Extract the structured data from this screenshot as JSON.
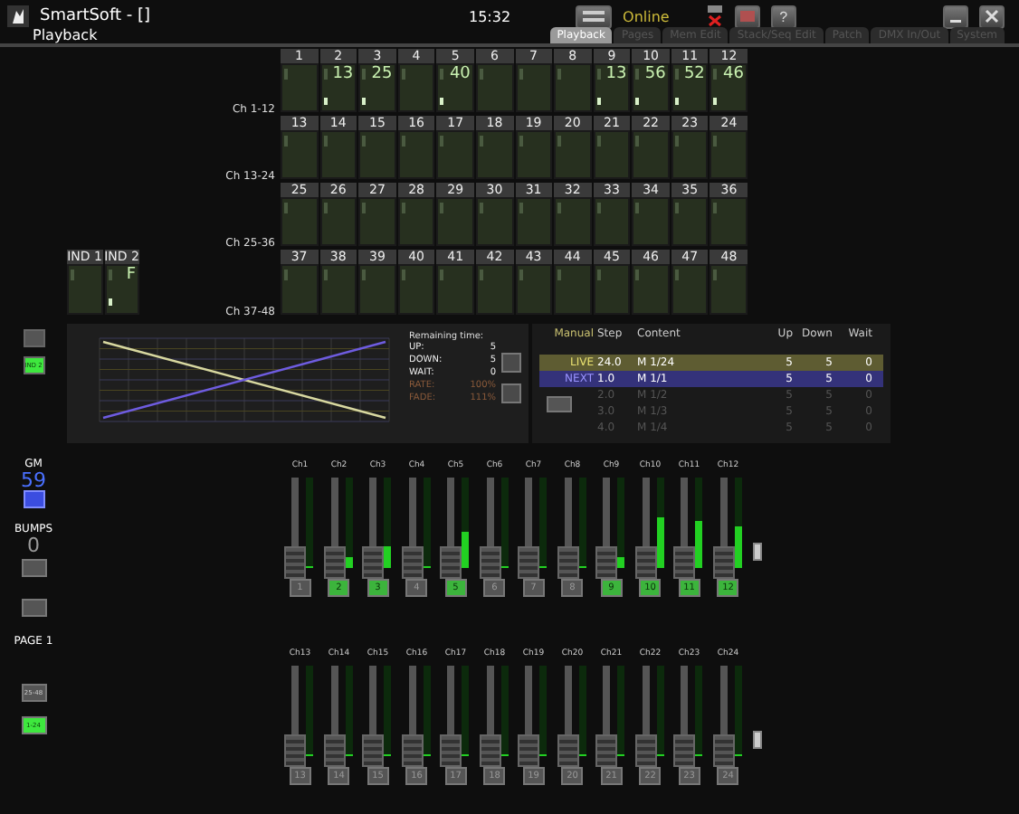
{
  "window": {
    "title": "SmartSoft - []",
    "clock": "15:32",
    "status": "Online",
    "help": "?"
  },
  "page_title": "Playback",
  "tabs": [
    {
      "label": "Playback",
      "selected": true
    },
    {
      "label": "Pages",
      "selected": false
    },
    {
      "label": "Mem Edit",
      "selected": false
    },
    {
      "label": "Stack/Seq Edit",
      "selected": false
    },
    {
      "label": "Patch",
      "selected": false
    },
    {
      "label": "DMX In/Out",
      "selected": false
    },
    {
      "label": "System",
      "selected": false
    }
  ],
  "channel_rows": [
    {
      "label": "Ch 1-12",
      "channels": [
        {
          "number": "1"
        },
        {
          "number": "2",
          "value": "13"
        },
        {
          "number": "3",
          "value": "25"
        },
        {
          "number": "4"
        },
        {
          "number": "5",
          "value": "40"
        },
        {
          "number": "6"
        },
        {
          "number": "7"
        },
        {
          "number": "8"
        },
        {
          "number": "9",
          "value": "13"
        },
        {
          "number": "10",
          "value": "56"
        },
        {
          "number": "11",
          "value": "52"
        },
        {
          "number": "12",
          "value": "46"
        }
      ]
    },
    {
      "label": "Ch 13-24",
      "channels": [
        {
          "number": "13"
        },
        {
          "number": "14"
        },
        {
          "number": "15"
        },
        {
          "number": "16"
        },
        {
          "number": "17"
        },
        {
          "number": "18"
        },
        {
          "number": "19"
        },
        {
          "number": "20"
        },
        {
          "number": "21"
        },
        {
          "number": "22"
        },
        {
          "number": "23"
        },
        {
          "number": "24"
        }
      ]
    },
    {
      "label": "Ch 25-36",
      "channels": [
        {
          "number": "25"
        },
        {
          "number": "26"
        },
        {
          "number": "27"
        },
        {
          "number": "28"
        },
        {
          "number": "29"
        },
        {
          "number": "30"
        },
        {
          "number": "31"
        },
        {
          "number": "32"
        },
        {
          "number": "33"
        },
        {
          "number": "34"
        },
        {
          "number": "35"
        },
        {
          "number": "36"
        }
      ]
    },
    {
      "label": "Ch 37-48",
      "channels": [
        {
          "number": "37"
        },
        {
          "number": "38"
        },
        {
          "number": "39"
        },
        {
          "number": "40"
        },
        {
          "number": "41"
        },
        {
          "number": "42"
        },
        {
          "number": "43"
        },
        {
          "number": "44"
        },
        {
          "number": "45"
        },
        {
          "number": "46"
        },
        {
          "number": "47"
        },
        {
          "number": "48"
        }
      ]
    }
  ],
  "indicators": [
    {
      "label": "IND 1"
    },
    {
      "label": "IND 2",
      "value": "F"
    }
  ],
  "ind_button": {
    "label": "IND 2",
    "selected": true
  },
  "remaining_time": {
    "title": "Remaining time:",
    "rows": [
      {
        "label": "UP:",
        "value": "5",
        "kind": "time"
      },
      {
        "label": "DOWN:",
        "value": "5",
        "kind": "time"
      },
      {
        "label": "WAIT:",
        "value": "0",
        "kind": "time"
      },
      {
        "label": "RATE:",
        "value": "100%",
        "kind": "rate"
      },
      {
        "label": "FADE:",
        "value": "111%",
        "kind": "rate"
      }
    ]
  },
  "cue_list": {
    "columns": [
      "Manual",
      "Step",
      "Content",
      "Up",
      "Down",
      "Wait"
    ],
    "rows": [
      {
        "kind": "live",
        "label": "LIVE",
        "step": "24.0",
        "content": "M 1/24",
        "up": "5",
        "down": "5",
        "wait": "0"
      },
      {
        "kind": "next",
        "label": "NEXT",
        "step": "1.0",
        "content": "M 1/1",
        "up": "5",
        "down": "5",
        "wait": "0"
      },
      {
        "kind": "pending",
        "step": "2.0",
        "content": "M 1/2",
        "up": "5",
        "down": "5",
        "wait": "0"
      },
      {
        "kind": "pending",
        "step": "3.0",
        "content": "M 1/3",
        "up": "5",
        "down": "5",
        "wait": "0"
      },
      {
        "kind": "pending",
        "step": "4.0",
        "content": "M 1/4",
        "up": "5",
        "down": "5",
        "wait": "0"
      }
    ]
  },
  "grand_master": {
    "label": "GM",
    "value": "59"
  },
  "bumps": {
    "label": "BUMPS",
    "value": "0"
  },
  "page": {
    "label": "PAGE 1"
  },
  "bank_buttons": [
    {
      "label": "25-48",
      "selected": false
    },
    {
      "label": "1-24",
      "selected": true
    }
  ],
  "fader_banks": [
    {
      "faders": [
        {
          "label": "Ch1",
          "button": "1",
          "selected": false,
          "level": 0
        },
        {
          "label": "Ch2",
          "button": "2",
          "selected": true,
          "level": 0.13
        },
        {
          "label": "Ch3",
          "button": "3",
          "selected": true,
          "level": 0.25
        },
        {
          "label": "Ch4",
          "button": "4",
          "selected": false,
          "level": 0
        },
        {
          "label": "Ch5",
          "button": "5",
          "selected": true,
          "level": 0.4
        },
        {
          "label": "Ch6",
          "button": "6",
          "selected": false,
          "level": 0
        },
        {
          "label": "Ch7",
          "button": "7",
          "selected": false,
          "level": 0
        },
        {
          "label": "Ch8",
          "button": "8",
          "selected": false,
          "level": 0
        },
        {
          "label": "Ch9",
          "button": "9",
          "selected": true,
          "level": 0.13
        },
        {
          "label": "Ch10",
          "button": "10",
          "selected": true,
          "level": 0.56
        },
        {
          "label": "Ch11",
          "button": "11",
          "selected": true,
          "level": 0.52
        },
        {
          "label": "Ch12",
          "button": "12",
          "selected": true,
          "level": 0.46
        }
      ]
    },
    {
      "faders": [
        {
          "label": "Ch13",
          "button": "13",
          "selected": false,
          "level": 0
        },
        {
          "label": "Ch14",
          "button": "14",
          "selected": false,
          "level": 0
        },
        {
          "label": "Ch15",
          "button": "15",
          "selected": false,
          "level": 0
        },
        {
          "label": "Ch16",
          "button": "16",
          "selected": false,
          "level": 0
        },
        {
          "label": "Ch17",
          "button": "17",
          "selected": false,
          "level": 0
        },
        {
          "label": "Ch18",
          "button": "18",
          "selected": false,
          "level": 0
        },
        {
          "label": "Ch19",
          "button": "19",
          "selected": false,
          "level": 0
        },
        {
          "label": "Ch20",
          "button": "20",
          "selected": false,
          "level": 0
        },
        {
          "label": "Ch21",
          "button": "21",
          "selected": false,
          "level": 0
        },
        {
          "label": "Ch22",
          "button": "22",
          "selected": false,
          "level": 0
        },
        {
          "label": "Ch23",
          "button": "23",
          "selected": false,
          "level": 0
        },
        {
          "label": "Ch24",
          "button": "24",
          "selected": false,
          "level": 0
        }
      ]
    }
  ]
}
